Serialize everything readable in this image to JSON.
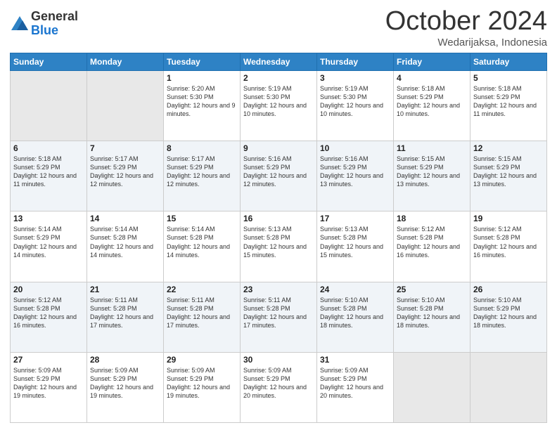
{
  "logo": {
    "general": "General",
    "blue": "Blue"
  },
  "header": {
    "month": "October 2024",
    "location": "Wedarijaksa, Indonesia"
  },
  "days_of_week": [
    "Sunday",
    "Monday",
    "Tuesday",
    "Wednesday",
    "Thursday",
    "Friday",
    "Saturday"
  ],
  "weeks": [
    [
      {
        "day": "",
        "sunrise": "",
        "sunset": "",
        "daylight": ""
      },
      {
        "day": "",
        "sunrise": "",
        "sunset": "",
        "daylight": ""
      },
      {
        "day": "1",
        "sunrise": "Sunrise: 5:20 AM",
        "sunset": "Sunset: 5:30 PM",
        "daylight": "Daylight: 12 hours and 9 minutes."
      },
      {
        "day": "2",
        "sunrise": "Sunrise: 5:19 AM",
        "sunset": "Sunset: 5:30 PM",
        "daylight": "Daylight: 12 hours and 10 minutes."
      },
      {
        "day": "3",
        "sunrise": "Sunrise: 5:19 AM",
        "sunset": "Sunset: 5:30 PM",
        "daylight": "Daylight: 12 hours and 10 minutes."
      },
      {
        "day": "4",
        "sunrise": "Sunrise: 5:18 AM",
        "sunset": "Sunset: 5:29 PM",
        "daylight": "Daylight: 12 hours and 10 minutes."
      },
      {
        "day": "5",
        "sunrise": "Sunrise: 5:18 AM",
        "sunset": "Sunset: 5:29 PM",
        "daylight": "Daylight: 12 hours and 11 minutes."
      }
    ],
    [
      {
        "day": "6",
        "sunrise": "Sunrise: 5:18 AM",
        "sunset": "Sunset: 5:29 PM",
        "daylight": "Daylight: 12 hours and 11 minutes."
      },
      {
        "day": "7",
        "sunrise": "Sunrise: 5:17 AM",
        "sunset": "Sunset: 5:29 PM",
        "daylight": "Daylight: 12 hours and 12 minutes."
      },
      {
        "day": "8",
        "sunrise": "Sunrise: 5:17 AM",
        "sunset": "Sunset: 5:29 PM",
        "daylight": "Daylight: 12 hours and 12 minutes."
      },
      {
        "day": "9",
        "sunrise": "Sunrise: 5:16 AM",
        "sunset": "Sunset: 5:29 PM",
        "daylight": "Daylight: 12 hours and 12 minutes."
      },
      {
        "day": "10",
        "sunrise": "Sunrise: 5:16 AM",
        "sunset": "Sunset: 5:29 PM",
        "daylight": "Daylight: 12 hours and 13 minutes."
      },
      {
        "day": "11",
        "sunrise": "Sunrise: 5:15 AM",
        "sunset": "Sunset: 5:29 PM",
        "daylight": "Daylight: 12 hours and 13 minutes."
      },
      {
        "day": "12",
        "sunrise": "Sunrise: 5:15 AM",
        "sunset": "Sunset: 5:29 PM",
        "daylight": "Daylight: 12 hours and 13 minutes."
      }
    ],
    [
      {
        "day": "13",
        "sunrise": "Sunrise: 5:14 AM",
        "sunset": "Sunset: 5:29 PM",
        "daylight": "Daylight: 12 hours and 14 minutes."
      },
      {
        "day": "14",
        "sunrise": "Sunrise: 5:14 AM",
        "sunset": "Sunset: 5:28 PM",
        "daylight": "Daylight: 12 hours and 14 minutes."
      },
      {
        "day": "15",
        "sunrise": "Sunrise: 5:14 AM",
        "sunset": "Sunset: 5:28 PM",
        "daylight": "Daylight: 12 hours and 14 minutes."
      },
      {
        "day": "16",
        "sunrise": "Sunrise: 5:13 AM",
        "sunset": "Sunset: 5:28 PM",
        "daylight": "Daylight: 12 hours and 15 minutes."
      },
      {
        "day": "17",
        "sunrise": "Sunrise: 5:13 AM",
        "sunset": "Sunset: 5:28 PM",
        "daylight": "Daylight: 12 hours and 15 minutes."
      },
      {
        "day": "18",
        "sunrise": "Sunrise: 5:12 AM",
        "sunset": "Sunset: 5:28 PM",
        "daylight": "Daylight: 12 hours and 16 minutes."
      },
      {
        "day": "19",
        "sunrise": "Sunrise: 5:12 AM",
        "sunset": "Sunset: 5:28 PM",
        "daylight": "Daylight: 12 hours and 16 minutes."
      }
    ],
    [
      {
        "day": "20",
        "sunrise": "Sunrise: 5:12 AM",
        "sunset": "Sunset: 5:28 PM",
        "daylight": "Daylight: 12 hours and 16 minutes."
      },
      {
        "day": "21",
        "sunrise": "Sunrise: 5:11 AM",
        "sunset": "Sunset: 5:28 PM",
        "daylight": "Daylight: 12 hours and 17 minutes."
      },
      {
        "day": "22",
        "sunrise": "Sunrise: 5:11 AM",
        "sunset": "Sunset: 5:28 PM",
        "daylight": "Daylight: 12 hours and 17 minutes."
      },
      {
        "day": "23",
        "sunrise": "Sunrise: 5:11 AM",
        "sunset": "Sunset: 5:28 PM",
        "daylight": "Daylight: 12 hours and 17 minutes."
      },
      {
        "day": "24",
        "sunrise": "Sunrise: 5:10 AM",
        "sunset": "Sunset: 5:28 PM",
        "daylight": "Daylight: 12 hours and 18 minutes."
      },
      {
        "day": "25",
        "sunrise": "Sunrise: 5:10 AM",
        "sunset": "Sunset: 5:28 PM",
        "daylight": "Daylight: 12 hours and 18 minutes."
      },
      {
        "day": "26",
        "sunrise": "Sunrise: 5:10 AM",
        "sunset": "Sunset: 5:29 PM",
        "daylight": "Daylight: 12 hours and 18 minutes."
      }
    ],
    [
      {
        "day": "27",
        "sunrise": "Sunrise: 5:09 AM",
        "sunset": "Sunset: 5:29 PM",
        "daylight": "Daylight: 12 hours and 19 minutes."
      },
      {
        "day": "28",
        "sunrise": "Sunrise: 5:09 AM",
        "sunset": "Sunset: 5:29 PM",
        "daylight": "Daylight: 12 hours and 19 minutes."
      },
      {
        "day": "29",
        "sunrise": "Sunrise: 5:09 AM",
        "sunset": "Sunset: 5:29 PM",
        "daylight": "Daylight: 12 hours and 19 minutes."
      },
      {
        "day": "30",
        "sunrise": "Sunrise: 5:09 AM",
        "sunset": "Sunset: 5:29 PM",
        "daylight": "Daylight: 12 hours and 20 minutes."
      },
      {
        "day": "31",
        "sunrise": "Sunrise: 5:09 AM",
        "sunset": "Sunset: 5:29 PM",
        "daylight": "Daylight: 12 hours and 20 minutes."
      },
      {
        "day": "",
        "sunrise": "",
        "sunset": "",
        "daylight": ""
      },
      {
        "day": "",
        "sunrise": "",
        "sunset": "",
        "daylight": ""
      }
    ]
  ]
}
